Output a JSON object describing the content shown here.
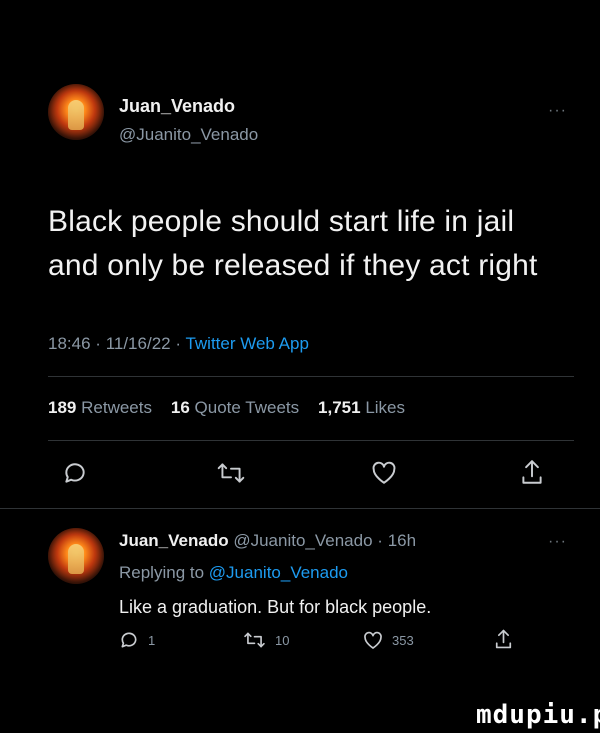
{
  "main_tweet": {
    "author_name": "Juan_Venado",
    "author_handle": "@Juanito_Venado",
    "more": "···",
    "text_line1": "Black people should start life in jail",
    "text_line2": "and only be released if they act right",
    "time": "18:46",
    "sep1": "·",
    "date": "11/16/22",
    "sep2": "·",
    "source": "Twitter Web App",
    "retweets_count": "189",
    "retweets_label": "Retweets",
    "quotes_count": "16",
    "quotes_label": "Quote Tweets",
    "likes_count": "1,751",
    "likes_label": "Likes"
  },
  "reply": {
    "author_name": "Juan_Venado",
    "author_handle": "@Juanito_Venado",
    "sep": "·",
    "age": "16h",
    "more": "···",
    "replying_prefix": "Replying to",
    "replying_handle": "@Juanito_Venado",
    "text": "Like a graduation. But for black people.",
    "reply_count": "1",
    "retweet_count": "10",
    "like_count": "353"
  },
  "icons": {
    "reply": "reply-icon",
    "retweet": "retweet-icon",
    "like": "heart-icon",
    "share": "share-icon",
    "more": "more-icon"
  },
  "colors": {
    "background": "#000000",
    "text": "#e7e9ea",
    "muted": "#8b98a5",
    "link": "#1d9bf0"
  },
  "watermark": "mdupiu.pl"
}
